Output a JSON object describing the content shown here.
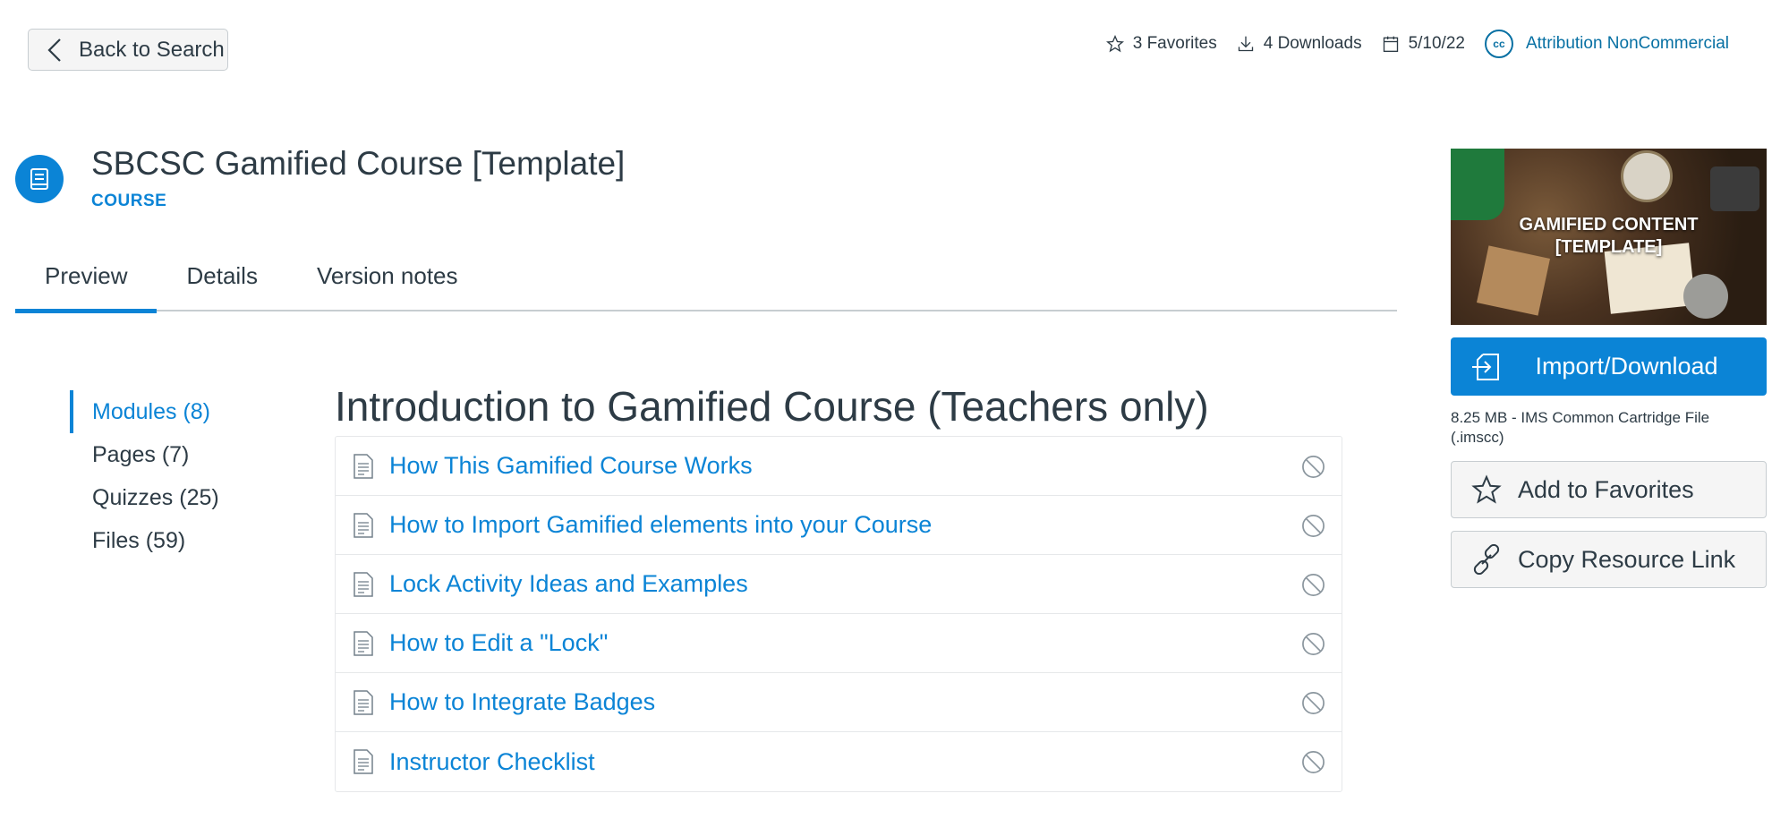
{
  "header": {
    "back_label": "Back to Search",
    "favorites": "3 Favorites",
    "downloads": "4 Downloads",
    "date": "5/10/22",
    "license_badge": "cc",
    "license": "Attribution NonCommercial"
  },
  "resource": {
    "title": "SBCSC Gamified Course [Template]",
    "type": "COURSE"
  },
  "tabs": [
    {
      "label": "Preview",
      "active": true
    },
    {
      "label": "Details",
      "active": false
    },
    {
      "label": "Version notes",
      "active": false
    }
  ],
  "side_nav": [
    {
      "label": "Modules (8)",
      "active": true
    },
    {
      "label": "Pages (7)",
      "active": false
    },
    {
      "label": "Quizzes (25)",
      "active": false
    },
    {
      "label": "Files (59)",
      "active": false
    }
  ],
  "module": {
    "title": "Introduction to Gamified Course (Teachers only)",
    "items": [
      {
        "label": "How This Gamified Course Works",
        "icon": "page-icon",
        "status_icon": "unpublished-icon"
      },
      {
        "label": "How to Import Gamified elements into your Course",
        "icon": "page-icon",
        "status_icon": "unpublished-icon"
      },
      {
        "label": "Lock Activity Ideas and Examples",
        "icon": "page-icon",
        "status_icon": "unpublished-icon"
      },
      {
        "label": "How to Edit a \"Lock\"",
        "icon": "page-icon",
        "status_icon": "unpublished-icon"
      },
      {
        "label": "How to Integrate Badges",
        "icon": "page-icon",
        "status_icon": "unpublished-icon"
      },
      {
        "label": "Instructor Checklist",
        "icon": "page-icon",
        "status_icon": "unpublished-icon"
      }
    ]
  },
  "sidebar": {
    "thumbnail_line1": "GAMIFIED CONTENT",
    "thumbnail_line2": "[TEMPLATE]",
    "import_label": "Import/Download",
    "file_info": "8.25 MB - IMS Common Cartridge File (.imscc)",
    "favorite_label": "Add to Favorites",
    "copy_link_label": "Copy Resource Link"
  },
  "colors": {
    "accent": "#0b84d6",
    "link": "#0b84d6",
    "text": "#2d3b45",
    "license": "#0770a3",
    "border": "#c7cdd1"
  }
}
